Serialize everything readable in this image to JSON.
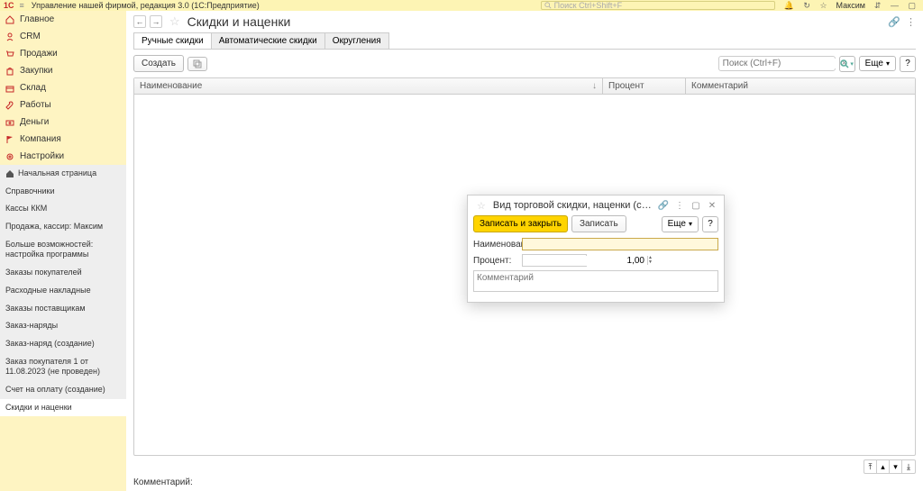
{
  "app": {
    "title": "Управление нашей фирмой, редакция 3.0  (1С:Предприятие)",
    "search_placeholder": "Поиск Ctrl+Shift+F",
    "user": "Максим"
  },
  "sidebar": {
    "main": [
      {
        "icon": "home",
        "label": "Главное"
      },
      {
        "icon": "crm",
        "label": "CRM"
      },
      {
        "icon": "cart",
        "label": "Продажи"
      },
      {
        "icon": "bag",
        "label": "Закупки"
      },
      {
        "icon": "box",
        "label": "Склад"
      },
      {
        "icon": "wrench",
        "label": "Работы"
      },
      {
        "icon": "money",
        "label": "Деньги"
      },
      {
        "icon": "flag",
        "label": "Компания"
      },
      {
        "icon": "gear",
        "label": "Настройки"
      }
    ],
    "sub": [
      {
        "label": "Начальная страница",
        "home": true
      },
      {
        "label": "Справочники"
      },
      {
        "label": "Кассы ККМ"
      },
      {
        "label": "Продажа, кассир: Максим"
      },
      {
        "label": "Больше возможностей: настройка программы"
      },
      {
        "label": "Заказы покупателей"
      },
      {
        "label": "Расходные накладные"
      },
      {
        "label": "Заказы поставщикам"
      },
      {
        "label": "Заказ-наряды"
      },
      {
        "label": "Заказ-наряд (создание)"
      },
      {
        "label": "Заказ покупателя 1 от 11.08.2023 (не проведен)"
      },
      {
        "label": "Счет на оплату (создание)"
      },
      {
        "label": "Скидки и наценки",
        "active": true
      }
    ]
  },
  "page": {
    "title": "Скидки и наценки",
    "tabs": [
      "Ручные скидки",
      "Автоматические скидки",
      "Округления"
    ],
    "active_tab": 0,
    "create_label": "Создать",
    "search_placeholder": "Поиск (Ctrl+F)",
    "more_label": "Еще",
    "columns": {
      "name": "Наименование",
      "percent": "Процент",
      "comment": "Комментарий"
    },
    "footer_label": "Комментарий:"
  },
  "dialog": {
    "title": "Вид торговой скидки, наценки (созд…",
    "save_close": "Записать и закрыть",
    "save": "Записать",
    "more": "Еще",
    "name_label": "Наименование:",
    "name_value": "",
    "percent_label": "Процент:",
    "percent_value": "1,00",
    "comment_placeholder": "Комментарий"
  }
}
